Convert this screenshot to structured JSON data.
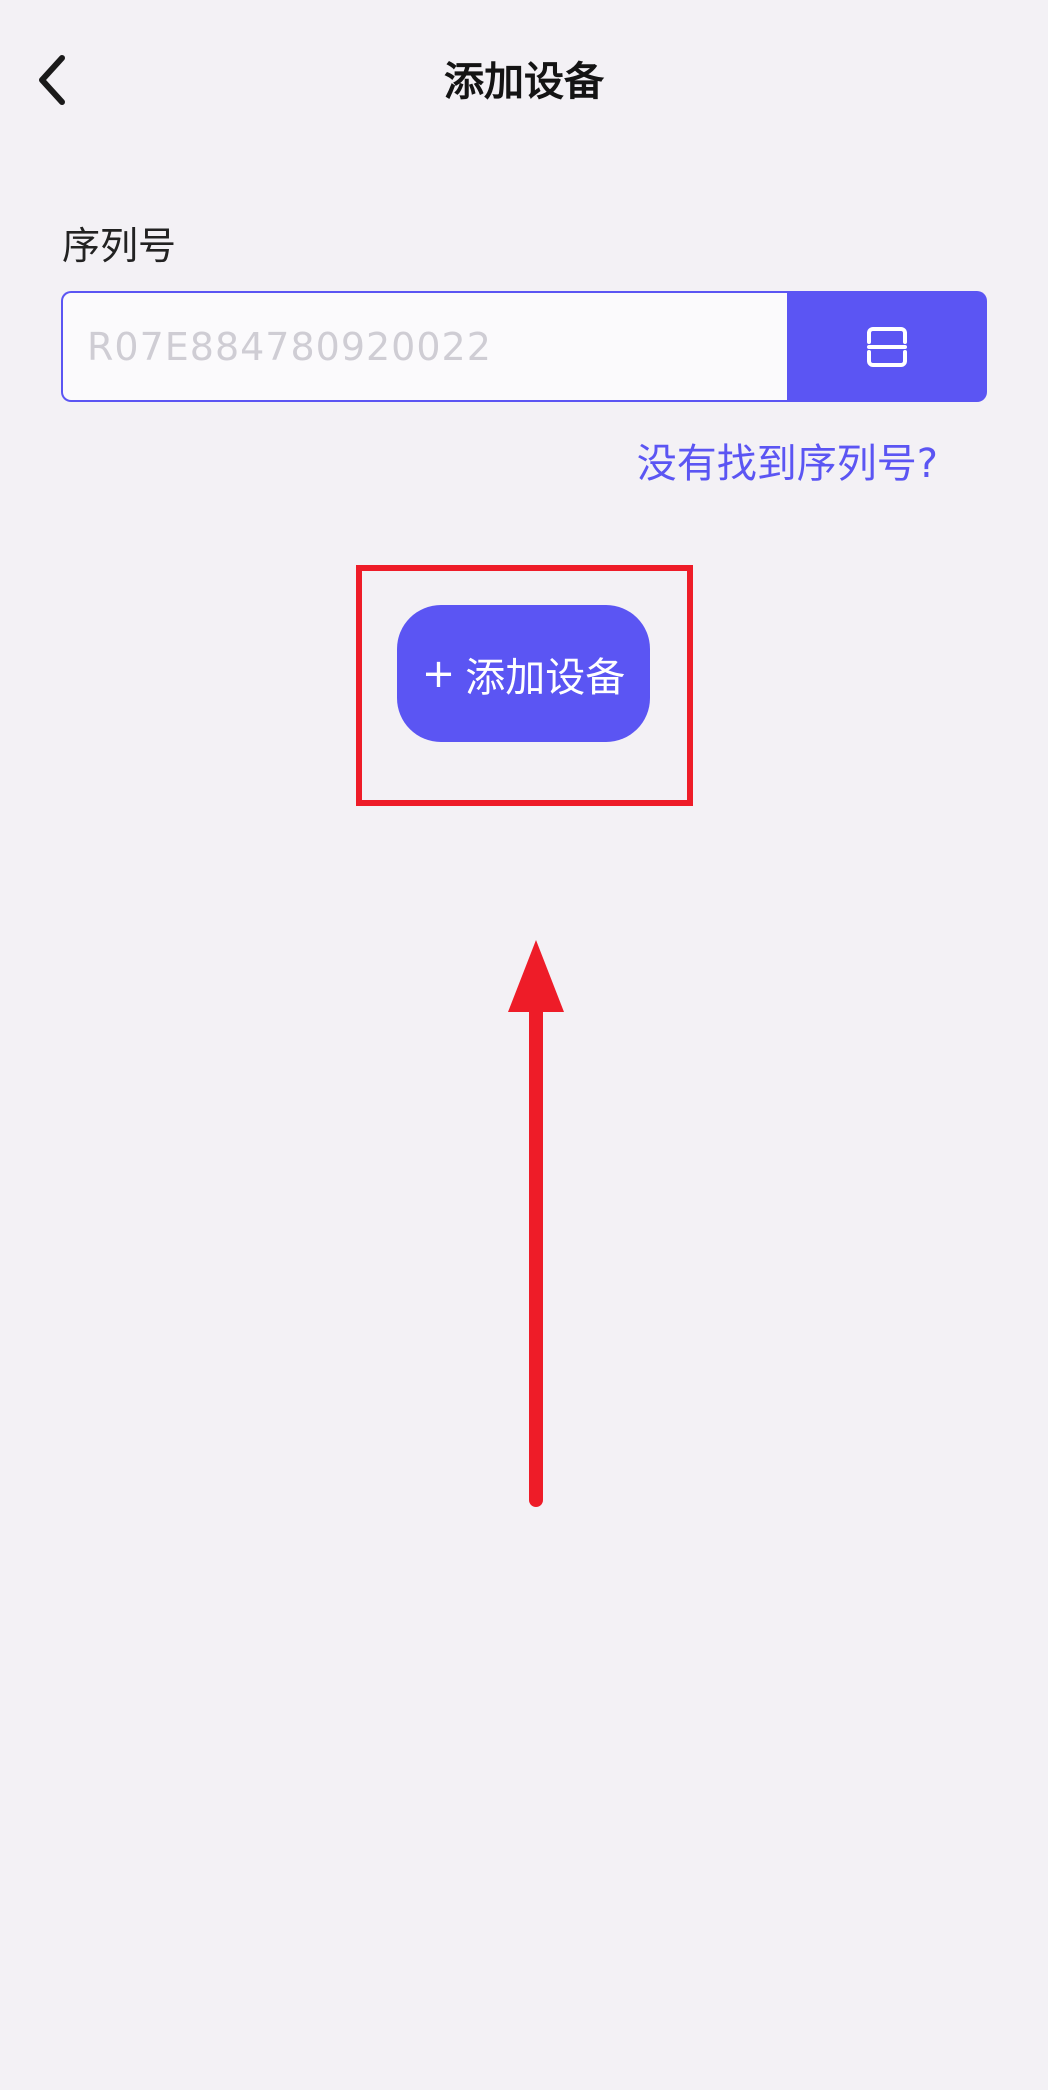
{
  "header": {
    "title": "添加设备",
    "back_icon": "chevron-left-icon"
  },
  "serial": {
    "label": "序列号",
    "placeholder": "R07E884780920022",
    "value": "",
    "scan_icon": "scan-icon"
  },
  "help_link": "没有找到序列号?",
  "add_button": {
    "plus": "+",
    "label": "添加设备"
  },
  "colors": {
    "background": "#f3f1f5",
    "accent": "#5b55f3",
    "annotation": "#ee1c28"
  }
}
